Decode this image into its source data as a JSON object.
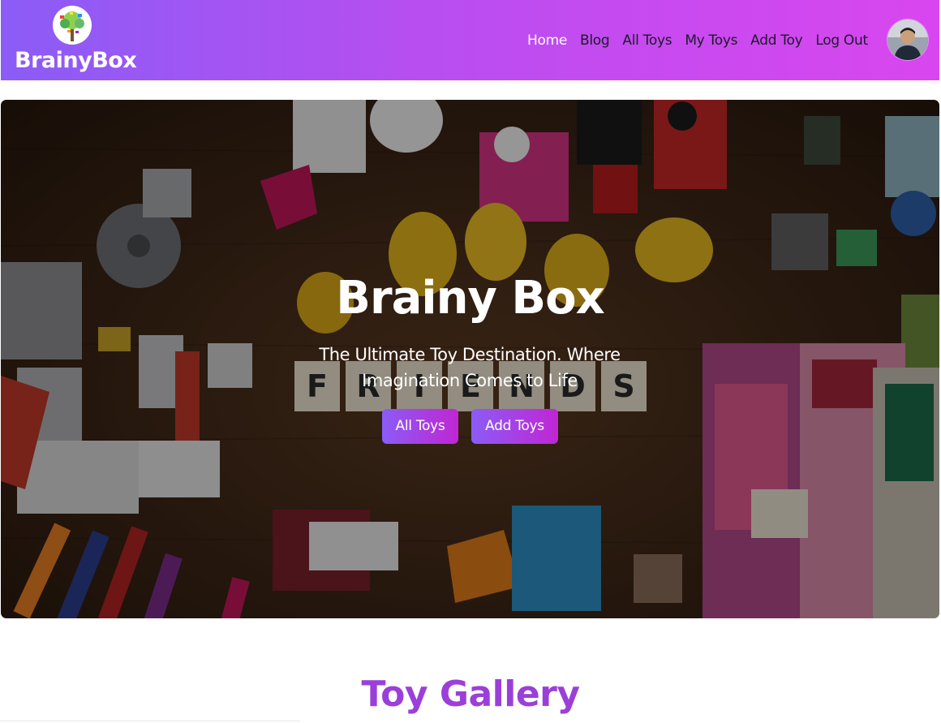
{
  "brand": {
    "name": "BrainyBox",
    "logo_icon": "tree-logo-icon"
  },
  "nav": {
    "links": [
      {
        "label": "Home",
        "active": true
      },
      {
        "label": "Blog",
        "active": false
      },
      {
        "label": "All Toys",
        "active": false
      },
      {
        "label": "My Toys",
        "active": false
      },
      {
        "label": "Add Toy",
        "active": false
      },
      {
        "label": "Log Out",
        "active": false
      }
    ],
    "avatar_icon": "user-avatar"
  },
  "hero": {
    "title": "Brainy Box",
    "subtitle": "The Ultimate Toy Destination. Where Imagination Comes to Life",
    "buttons": {
      "all_toys": "All Toys",
      "add_toys": "Add Toys"
    },
    "tiles": [
      "F",
      "R",
      "I",
      "E",
      "N",
      "D",
      "S"
    ]
  },
  "gallery": {
    "title": "Toy Gallery"
  },
  "colors": {
    "nav_gradient_start": "#8b5cf6",
    "nav_gradient_end": "#d946ef",
    "button_gradient_start": "#8b5cf6",
    "button_gradient_end": "#c026d3",
    "gallery_title": "#9b3fd9"
  }
}
